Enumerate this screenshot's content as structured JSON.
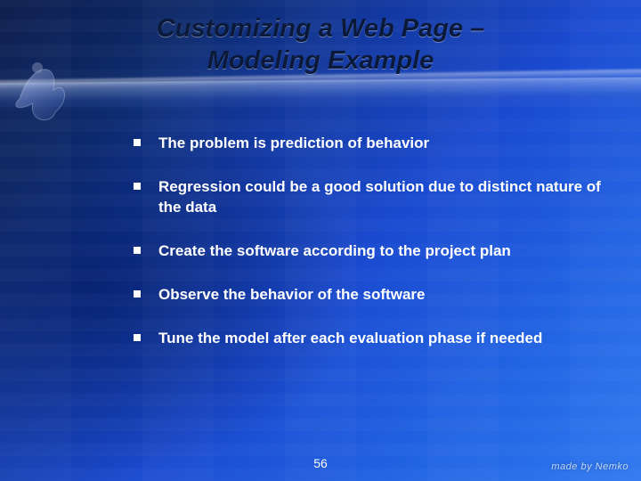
{
  "title_line1": "Customizing a Web Page –",
  "title_line2": "Modeling Example",
  "bullets": [
    "The problem is prediction of behavior",
    "Regression could be a good solution due to distinct nature of the data",
    "Create the software according to the project plan",
    "Observe the behavior of the software",
    "Tune the model after each evaluation phase if needed"
  ],
  "page_number": "56",
  "brand": "made by Nemko"
}
